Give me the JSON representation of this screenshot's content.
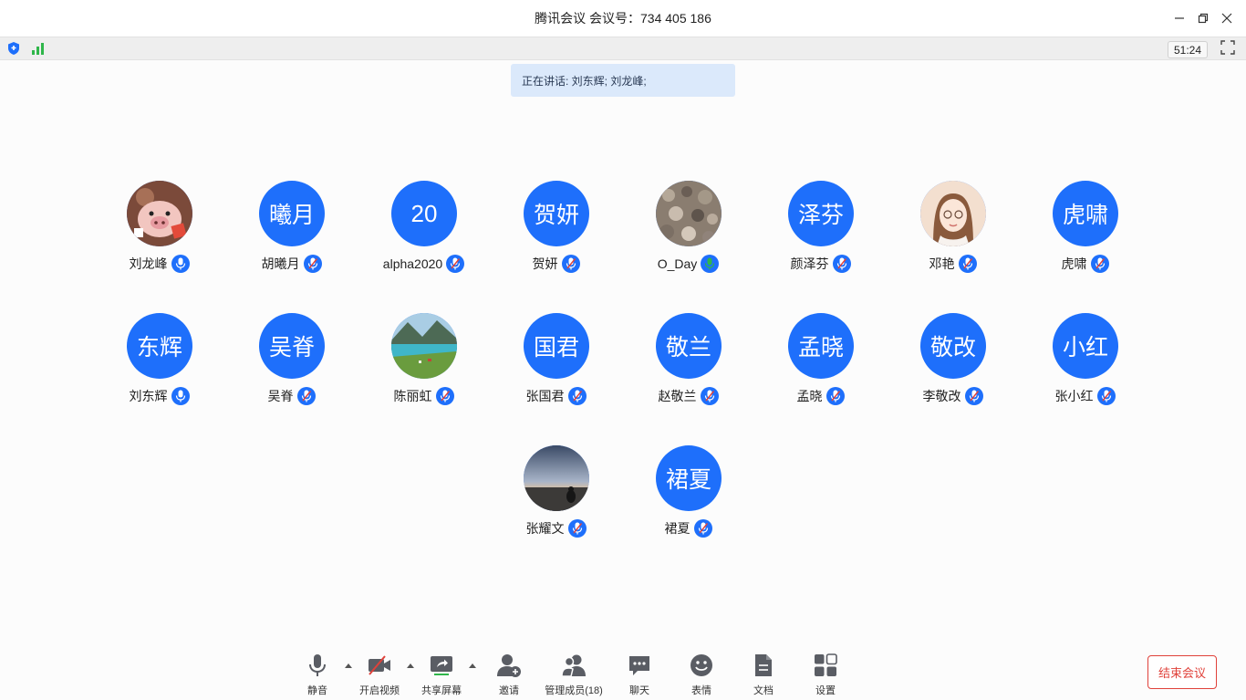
{
  "window": {
    "title": "腾讯会议 会议号：734 405 186",
    "minimize_icon": "minimize-icon",
    "restore_icon": "restore-icon",
    "close_icon": "close-icon"
  },
  "status": {
    "timer": "51:24",
    "security_icon": "shield-icon",
    "signal_icon": "signal-icon",
    "fullscreen_icon": "fullscreen-icon"
  },
  "speaking": {
    "text": "正在讲话: 刘东辉; 刘龙峰;"
  },
  "colors": {
    "accent": "#1e6ffb",
    "end": "#e0413a",
    "mic_green": "#2fb64a"
  },
  "participants": [
    {
      "name": "刘龙峰",
      "avatar_type": "photo-pig",
      "mic": "active"
    },
    {
      "name": "胡曦月",
      "avatar_text": "曦月",
      "mic": "muted"
    },
    {
      "name": "alpha2020",
      "avatar_text": "20",
      "mic": "muted"
    },
    {
      "name": "贺妍",
      "avatar_text": "贺妍",
      "mic": "muted"
    },
    {
      "name": "O_Day",
      "avatar_type": "photo-rocks",
      "mic": "speaking-green"
    },
    {
      "name": "颜泽芬",
      "avatar_text": "泽芬",
      "mic": "muted"
    },
    {
      "name": "邓艳",
      "avatar_type": "photo-girl",
      "mic": "muted"
    },
    {
      "name": "虎啸",
      "avatar_text": "虎啸",
      "mic": "muted"
    },
    {
      "name": "刘东辉",
      "avatar_text": "东辉",
      "mic": "active"
    },
    {
      "name": "吴脊",
      "avatar_text": "吴脊",
      "mic": "muted"
    },
    {
      "name": "陈丽虹",
      "avatar_type": "photo-lake",
      "mic": "muted"
    },
    {
      "name": "张国君",
      "avatar_text": "国君",
      "mic": "muted"
    },
    {
      "name": "赵敬兰",
      "avatar_text": "敬兰",
      "mic": "muted"
    },
    {
      "name": "孟晓",
      "avatar_text": "孟晓",
      "mic": "muted"
    },
    {
      "name": "李敬改",
      "avatar_text": "敬改",
      "mic": "muted"
    },
    {
      "name": "张小红",
      "avatar_text": "小红",
      "mic": "muted"
    },
    {
      "name": "张耀文",
      "avatar_type": "photo-sunset",
      "mic": "muted"
    },
    {
      "name": "裙夏",
      "avatar_text": "裙夏",
      "mic": "muted"
    }
  ],
  "toolbar": {
    "mute": "静音",
    "video": "开启视频",
    "share": "共享屏幕",
    "invite": "邀请",
    "members": "管理成员(18)",
    "chat": "聊天",
    "emoji": "表情",
    "docs": "文档",
    "settings": "设置",
    "end": "结束会议"
  }
}
